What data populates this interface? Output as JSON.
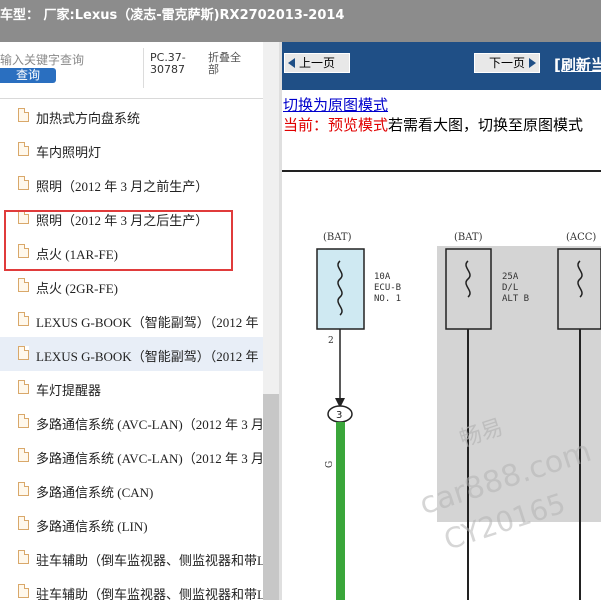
{
  "window": {
    "title": "车型： 厂家:Lexus（凌志-雷克萨斯)RX2702013-2014"
  },
  "search": {
    "placeholder": "输入关键字查询",
    "button_label": "查询",
    "pc_code": "PC.37-30787",
    "collapse_label": "折叠全部"
  },
  "tree": {
    "items": [
      {
        "label": "加热式方向盘系统"
      },
      {
        "label": "车内照明灯"
      },
      {
        "label": "照明（2012 年 3 月之前生产）"
      },
      {
        "label": "照明（2012 年 3 月之后生产）"
      },
      {
        "label": "点火 (1AR-FE)"
      },
      {
        "label": "点火 (2GR-FE)"
      },
      {
        "label": "LEXUS G-BOOK（智能副驾）（2012 年"
      },
      {
        "label": "LEXUS G-BOOK（智能副驾）（2012 年"
      },
      {
        "label": "车灯提醒器"
      },
      {
        "label": "多路通信系统 (AVC-LAN)（2012 年 3 月"
      },
      {
        "label": "多路通信系统 (AVC-LAN)（2012 年 3 月"
      },
      {
        "label": "多路通信系统 (CAN)"
      },
      {
        "label": "多路通信系统 (LIN)"
      },
      {
        "label": "驻车辅助（倒车监视器、侧监视器和带L"
      },
      {
        "label": "驻车辅助（倒车监视器、侧监视器和带L"
      }
    ]
  },
  "viewer": {
    "prev_label": "上一页",
    "next_label": "下一页",
    "refresh_label": "[刷新当",
    "switch_link": "切换为原图模式",
    "status_prefix": "当前：预览模式",
    "status_text": "若需看大图，切换至原图模式"
  },
  "diagram": {
    "bat_label_1": "(BAT)",
    "bat_label_2": "(BAT)",
    "acc_label": "(ACC)",
    "fuse1_rating": "10A",
    "fuse1_name": "ECU-B",
    "fuse1_no": "NO. 1",
    "fuse2_rating": "25A",
    "fuse2_name": "D/L",
    "fuse2_alt": "ALT B",
    "pin_number": "2",
    "connector_number": "3",
    "wire_color": "G",
    "watermark_1": "畅易",
    "watermark_2": "car888.com",
    "watermark_3": "CY20165"
  },
  "colors": {
    "nav_bar": "#1f4f86",
    "highlight_box": "#e03b3b",
    "wire_green": "#3aa63a",
    "fuse_fill": "#cfe9f2",
    "status_red": "#e00000"
  }
}
